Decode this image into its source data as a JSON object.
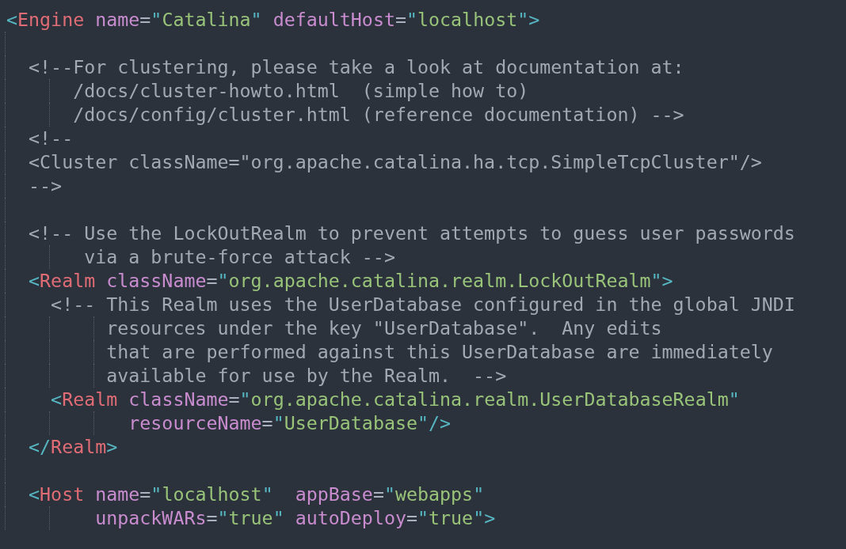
{
  "editor": {
    "lines": [
      {
        "tokens": [
          {
            "kind": "punct",
            "text": "<"
          },
          {
            "kind": "tag",
            "text": "Engine"
          },
          {
            "kind": "attr",
            "text": " name"
          },
          {
            "kind": "plain",
            "text": "="
          },
          {
            "kind": "punct",
            "text": "\""
          },
          {
            "kind": "string",
            "text": "Catalina"
          },
          {
            "kind": "punct",
            "text": "\""
          },
          {
            "kind": "attr",
            "text": " defaultHost"
          },
          {
            "kind": "plain",
            "text": "="
          },
          {
            "kind": "punct",
            "text": "\""
          },
          {
            "kind": "string",
            "text": "localhost"
          },
          {
            "kind": "punct",
            "text": "\">"
          }
        ]
      },
      {
        "blank_before": true,
        "tokens": [
          {
            "kind": "comment",
            "text": "  <!--For clustering, please take a look at documentation at:"
          }
        ]
      },
      {
        "tokens": [
          {
            "kind": "comment",
            "text": "      /docs/cluster-howto.html  (simple how to)"
          }
        ]
      },
      {
        "tokens": [
          {
            "kind": "comment",
            "text": "      /docs/config/cluster.html (reference documentation) -->"
          }
        ]
      },
      {
        "tokens": [
          {
            "kind": "comment",
            "text": "  <!--"
          }
        ]
      },
      {
        "tokens": [
          {
            "kind": "comment",
            "text": "  <Cluster className=\"org.apache.catalina.ha.tcp.SimpleTcpCluster\"/>"
          }
        ]
      },
      {
        "tokens": [
          {
            "kind": "comment",
            "text": "  -->"
          }
        ]
      },
      {
        "blank_before": true,
        "tokens": [
          {
            "kind": "comment",
            "text": "  <!-- Use the LockOutRealm to prevent attempts to guess user passwords"
          }
        ]
      },
      {
        "tokens": [
          {
            "kind": "comment",
            "text": "       via a brute-force attack -->"
          }
        ]
      },
      {
        "tokens": [
          {
            "kind": "punct",
            "text": "  <"
          },
          {
            "kind": "tag",
            "text": "Realm"
          },
          {
            "kind": "attr",
            "text": " className"
          },
          {
            "kind": "plain",
            "text": "="
          },
          {
            "kind": "punct",
            "text": "\""
          },
          {
            "kind": "string",
            "text": "org.apache.catalina.realm.LockOutRealm"
          },
          {
            "kind": "punct",
            "text": "\">"
          }
        ]
      },
      {
        "tokens": [
          {
            "kind": "comment",
            "text": "    <!-- This Realm uses the UserDatabase configured in the global JNDI"
          }
        ]
      },
      {
        "tokens": [
          {
            "kind": "comment",
            "text": "         resources under the key \"UserDatabase\".  Any edits"
          }
        ]
      },
      {
        "tokens": [
          {
            "kind": "comment",
            "text": "         that are performed against this UserDatabase are immediately"
          }
        ]
      },
      {
        "tokens": [
          {
            "kind": "comment",
            "text": "         available for use by the Realm.  -->"
          }
        ]
      },
      {
        "tokens": [
          {
            "kind": "punct",
            "text": "    <"
          },
          {
            "kind": "tag",
            "text": "Realm"
          },
          {
            "kind": "attr",
            "text": " className"
          },
          {
            "kind": "plain",
            "text": "="
          },
          {
            "kind": "punct",
            "text": "\""
          },
          {
            "kind": "string",
            "text": "org.apache.catalina.realm.UserDatabaseRealm"
          },
          {
            "kind": "punct",
            "text": "\""
          }
        ]
      },
      {
        "tokens": [
          {
            "kind": "attr",
            "text": "           resourceName"
          },
          {
            "kind": "plain",
            "text": "="
          },
          {
            "kind": "punct",
            "text": "\""
          },
          {
            "kind": "string",
            "text": "UserDatabase"
          },
          {
            "kind": "punct",
            "text": "\"/>"
          }
        ]
      },
      {
        "tokens": [
          {
            "kind": "punct",
            "text": "  </"
          },
          {
            "kind": "tag",
            "text": "Realm"
          },
          {
            "kind": "punct",
            "text": ">"
          }
        ]
      },
      {
        "blank_before": true,
        "tokens": [
          {
            "kind": "punct",
            "text": "  <"
          },
          {
            "kind": "tag",
            "text": "Host"
          },
          {
            "kind": "attr",
            "text": " name"
          },
          {
            "kind": "plain",
            "text": "="
          },
          {
            "kind": "punct",
            "text": "\""
          },
          {
            "kind": "string",
            "text": "localhost"
          },
          {
            "kind": "punct",
            "text": "\""
          },
          {
            "kind": "attr",
            "text": "  appBase"
          },
          {
            "kind": "plain",
            "text": "="
          },
          {
            "kind": "punct",
            "text": "\""
          },
          {
            "kind": "string",
            "text": "webapps"
          },
          {
            "kind": "punct",
            "text": "\""
          }
        ]
      },
      {
        "tokens": [
          {
            "kind": "attr",
            "text": "        unpackWARs"
          },
          {
            "kind": "plain",
            "text": "="
          },
          {
            "kind": "punct",
            "text": "\""
          },
          {
            "kind": "string",
            "text": "true"
          },
          {
            "kind": "punct",
            "text": "\""
          },
          {
            "kind": "attr",
            "text": " autoDeploy"
          },
          {
            "kind": "plain",
            "text": "="
          },
          {
            "kind": "punct",
            "text": "\""
          },
          {
            "kind": "string",
            "text": "true"
          },
          {
            "kind": "punct",
            "text": "\">"
          }
        ]
      }
    ]
  }
}
